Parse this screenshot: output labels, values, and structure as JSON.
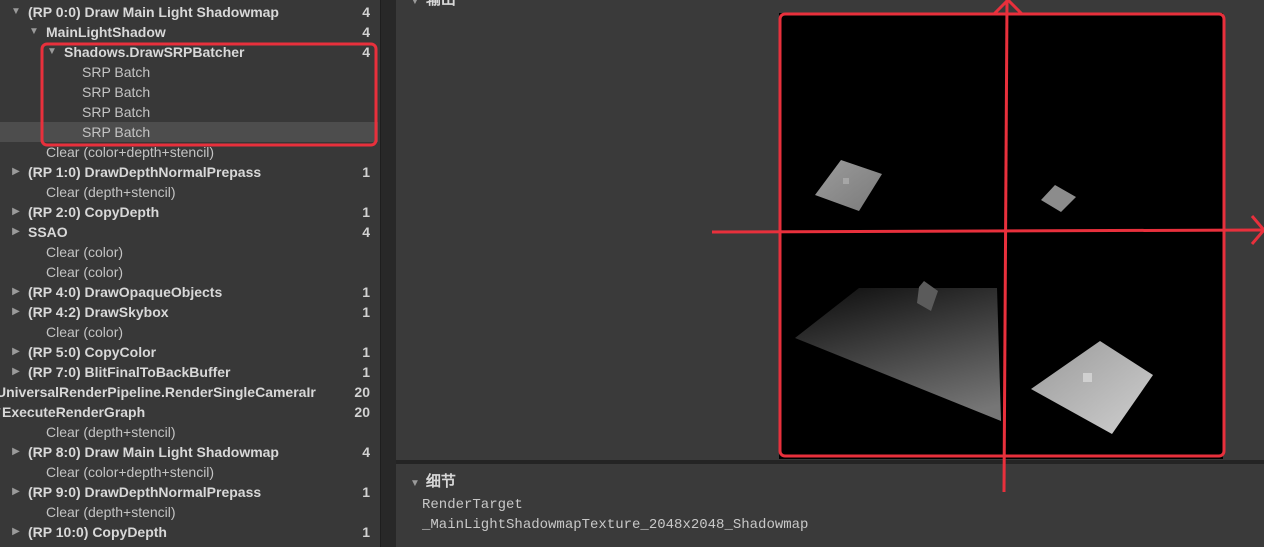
{
  "tree": [
    {
      "label": "(RP 0:0) Draw Main Light Shadowmap",
      "count": "4",
      "bold": true,
      "indent": 0,
      "arrow": "expanded",
      "selected": false
    },
    {
      "label": "MainLightShadow",
      "count": "4",
      "bold": true,
      "indent": 1,
      "arrow": "expanded",
      "selected": false
    },
    {
      "label": "Shadows.DrawSRPBatcher",
      "count": "4",
      "bold": true,
      "indent": 2,
      "arrow": "expanded",
      "selected": false
    },
    {
      "label": "SRP Batch",
      "count": "",
      "bold": false,
      "indent": 3,
      "arrow": "none",
      "selected": false
    },
    {
      "label": "SRP Batch",
      "count": "",
      "bold": false,
      "indent": 3,
      "arrow": "none",
      "selected": false
    },
    {
      "label": "SRP Batch",
      "count": "",
      "bold": false,
      "indent": 3,
      "arrow": "none",
      "selected": false
    },
    {
      "label": "SRP Batch",
      "count": "",
      "bold": false,
      "indent": 3,
      "arrow": "none",
      "selected": true
    },
    {
      "label": "Clear (color+depth+stencil)",
      "count": "",
      "bold": false,
      "indent": 1,
      "arrow": "none",
      "selected": false
    },
    {
      "label": "(RP 1:0) DrawDepthNormalPrepass",
      "count": "1",
      "bold": true,
      "indent": 0,
      "arrow": "collapsed",
      "selected": false
    },
    {
      "label": "Clear (depth+stencil)",
      "count": "",
      "bold": false,
      "indent": 1,
      "arrow": "none",
      "selected": false
    },
    {
      "label": "(RP 2:0) CopyDepth",
      "count": "1",
      "bold": true,
      "indent": 0,
      "arrow": "collapsed",
      "selected": false
    },
    {
      "label": "SSAO",
      "count": "4",
      "bold": true,
      "indent": 0,
      "arrow": "collapsed",
      "selected": false
    },
    {
      "label": "Clear (color)",
      "count": "",
      "bold": false,
      "indent": 1,
      "arrow": "none",
      "selected": false
    },
    {
      "label": "Clear (color)",
      "count": "",
      "bold": false,
      "indent": 1,
      "arrow": "none",
      "selected": false
    },
    {
      "label": "(RP 4:0) DrawOpaqueObjects",
      "count": "1",
      "bold": true,
      "indent": 0,
      "arrow": "collapsed",
      "selected": false
    },
    {
      "label": "(RP 4:2) DrawSkybox",
      "count": "1",
      "bold": true,
      "indent": 0,
      "arrow": "collapsed",
      "selected": false
    },
    {
      "label": "Clear (color)",
      "count": "",
      "bold": false,
      "indent": 1,
      "arrow": "none",
      "selected": false
    },
    {
      "label": "(RP 5:0) CopyColor",
      "count": "1",
      "bold": true,
      "indent": 0,
      "arrow": "collapsed",
      "selected": false
    },
    {
      "label": "(RP 7:0) BlitFinalToBackBuffer",
      "count": "1",
      "bold": true,
      "indent": 0,
      "arrow": "collapsed",
      "selected": false
    },
    {
      "label": "UniversalRenderPipeline.RenderSingleCameraIr",
      "count": "20",
      "bold": true,
      "indent": -1,
      "arrow": "none",
      "selected": false
    },
    {
      "label": "ExecuteRenderGraph",
      "count": "20",
      "bold": true,
      "indent": -1,
      "arrow": "expanded",
      "selected": false
    },
    {
      "label": "Clear (depth+stencil)",
      "count": "",
      "bold": false,
      "indent": 1,
      "arrow": "none",
      "selected": false
    },
    {
      "label": "(RP 8:0) Draw Main Light Shadowmap",
      "count": "4",
      "bold": true,
      "indent": 0,
      "arrow": "collapsed",
      "selected": false
    },
    {
      "label": "Clear (color+depth+stencil)",
      "count": "",
      "bold": false,
      "indent": 1,
      "arrow": "none",
      "selected": false
    },
    {
      "label": "(RP 9:0) DrawDepthNormalPrepass",
      "count": "1",
      "bold": true,
      "indent": 0,
      "arrow": "collapsed",
      "selected": false
    },
    {
      "label": "Clear (depth+stencil)",
      "count": "",
      "bold": false,
      "indent": 1,
      "arrow": "none",
      "selected": false
    },
    {
      "label": "(RP 10:0) CopyDepth",
      "count": "1",
      "bold": true,
      "indent": 0,
      "arrow": "collapsed",
      "selected": false
    }
  ],
  "output": {
    "title": "输出"
  },
  "details": {
    "title": "细节",
    "line1": "RenderTarget",
    "line2": "_MainLightShadowmapTexture_2048x2048_Shadowmap"
  },
  "icons": {
    "expanded": "triangle-down-icon",
    "collapsed": "triangle-right-icon"
  },
  "colors": {
    "annotation": "#e8303c",
    "selection": "#4d4d4d",
    "background": "#383838"
  }
}
